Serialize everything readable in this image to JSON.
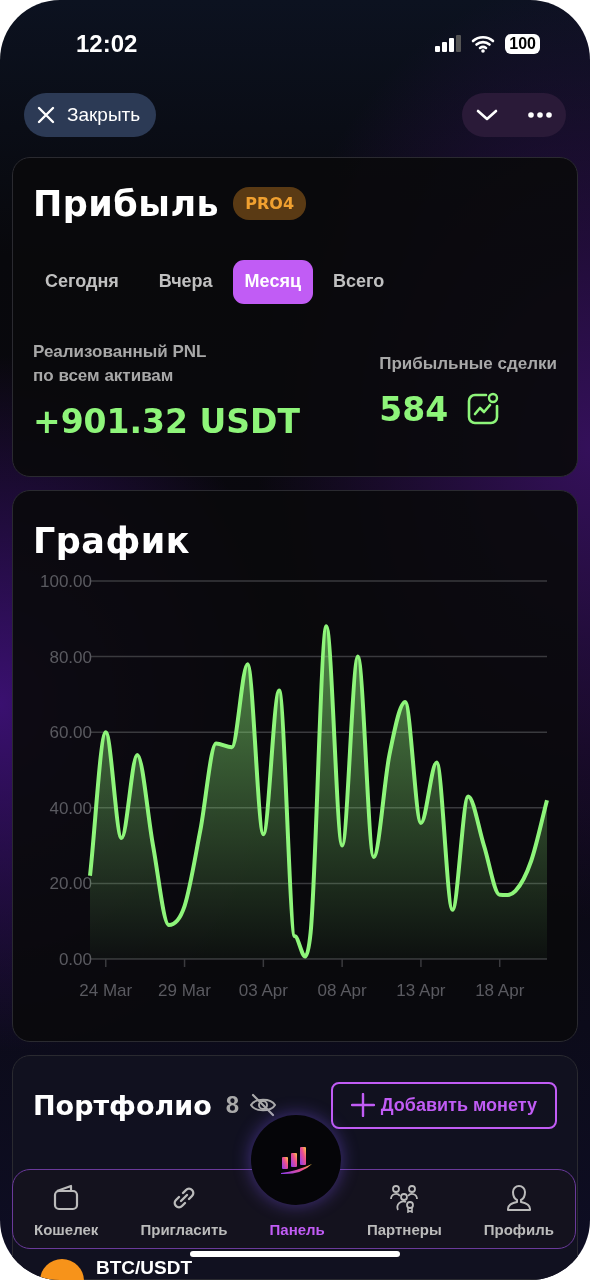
{
  "status_bar": {
    "time": "12:02",
    "battery": "100"
  },
  "header": {
    "close_label": "Закрыть"
  },
  "profit": {
    "title": "Прибыль",
    "badge": "PRO4",
    "tabs": [
      {
        "label": "Сегодня",
        "selected": false
      },
      {
        "label": "Вчера",
        "selected": false
      },
      {
        "label": "Месяц",
        "selected": true
      },
      {
        "label": "Всего",
        "selected": false
      }
    ],
    "pnl_label": "Реализованный PNL\nпо всем активам",
    "pnl_value": "+901.32 USDT",
    "trades_label": "Прибыльные сделки",
    "trades_value": "584"
  },
  "chart": {
    "title": "График",
    "chart_data": {
      "type": "area",
      "categories": [
        null,
        "24 Mar",
        null,
        null,
        null,
        null,
        "29 Mar",
        null,
        null,
        null,
        null,
        "03 Apr",
        null,
        null,
        null,
        null,
        "08 Apr",
        null,
        null,
        null,
        null,
        "13 Apr",
        null,
        null,
        null,
        null,
        "18 Apr",
        null,
        null,
        null
      ],
      "series": [
        {
          "color": "#8ef57a",
          "values": [
            22,
            60,
            32,
            54,
            30,
            9,
            14,
            34,
            57,
            56,
            78,
            33,
            71,
            6,
            7,
            88,
            30,
            80,
            27,
            54,
            68,
            36,
            52,
            13,
            43,
            30,
            17,
            18,
            26,
            42
          ]
        }
      ],
      "ylim": [
        0,
        100
      ],
      "grid": true,
      "yticks": [
        {
          "value": 0,
          "label": "0.00"
        },
        {
          "value": 20,
          "label": "20.00"
        },
        {
          "value": 40,
          "label": "40.00"
        },
        {
          "value": 60,
          "label": "60.00"
        },
        {
          "value": 80,
          "label": "80.00"
        },
        {
          "value": 100,
          "label": "100.00"
        }
      ]
    }
  },
  "portfolio": {
    "title": "Портфолио",
    "count": "8",
    "add_button": "Добавить монету",
    "row": {
      "pair": "BTC/USDT"
    }
  },
  "nav": [
    {
      "kind": "wallet",
      "label": "Кошелек",
      "selected": false
    },
    {
      "kind": "link",
      "label": "Пригласить",
      "selected": false
    },
    {
      "kind": "panel",
      "label": "Панель",
      "selected": true
    },
    {
      "kind": "partners",
      "label": "Партнеры",
      "selected": false
    },
    {
      "kind": "profile",
      "label": "Профиль",
      "selected": false
    }
  ]
}
